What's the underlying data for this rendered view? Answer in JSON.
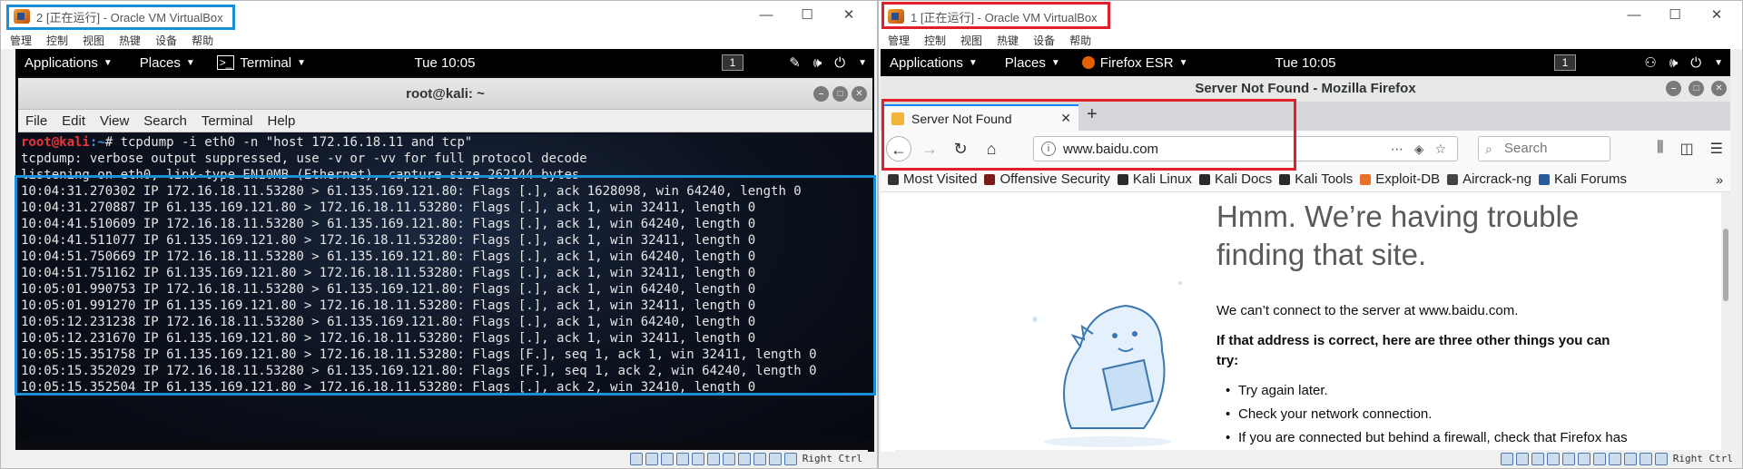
{
  "left_vm": {
    "title": "2 [正在运行] - Oracle VM VirtualBox",
    "menu": [
      "管理",
      "控制",
      "视图",
      "热键",
      "设备",
      "帮助"
    ],
    "gnome": {
      "applications": "Applications",
      "places": "Places",
      "app": "Terminal",
      "clock": "Tue 10:05",
      "workspace": "1"
    },
    "terminal": {
      "title": "root@kali: ~",
      "menu": [
        "File",
        "Edit",
        "View",
        "Search",
        "Terminal",
        "Help"
      ],
      "prompt_user": "root@kali",
      "prompt_path": ":~",
      "prompt_rest": "# tcpdump -i eth0 -n \"host 172.16.18.11 and tcp\"",
      "lines": [
        "tcpdump: verbose output suppressed, use -v or -vv for full protocol decode",
        "listening on eth0, link-type EN10MB (Ethernet), capture size 262144 bytes",
        "10:04:31.270302 IP 172.16.18.11.53280 > 61.135.169.121.80: Flags [.], ack 1628098, win 64240, length 0",
        "10:04:31.270887 IP 61.135.169.121.80 > 172.16.18.11.53280: Flags [.], ack 1, win 32411, length 0",
        "10:04:41.510609 IP 172.16.18.11.53280 > 61.135.169.121.80: Flags [.], ack 1, win 64240, length 0",
        "10:04:41.511077 IP 61.135.169.121.80 > 172.16.18.11.53280: Flags [.], ack 1, win 32411, length 0",
        "10:04:51.750669 IP 172.16.18.11.53280 > 61.135.169.121.80: Flags [.], ack 1, win 64240, length 0",
        "10:04:51.751162 IP 61.135.169.121.80 > 172.16.18.11.53280: Flags [.], ack 1, win 32411, length 0",
        "10:05:01.990753 IP 172.16.18.11.53280 > 61.135.169.121.80: Flags [.], ack 1, win 64240, length 0",
        "10:05:01.991270 IP 61.135.169.121.80 > 172.16.18.11.53280: Flags [.], ack 1, win 32411, length 0",
        "10:05:12.231238 IP 172.16.18.11.53280 > 61.135.169.121.80: Flags [.], ack 1, win 64240, length 0",
        "10:05:12.231670 IP 61.135.169.121.80 > 172.16.18.11.53280: Flags [.], ack 1, win 32411, length 0",
        "10:05:15.351758 IP 61.135.169.121.80 > 172.16.18.11.53280: Flags [F.], seq 1, ack 1, win 32411, length 0",
        "10:05:15.352029 IP 172.16.18.11.53280 > 61.135.169.121.80: Flags [F.], seq 1, ack 2, win 64240, length 0",
        "10:05:15.352504 IP 61.135.169.121.80 > 172.16.18.11.53280: Flags [.], ack 2, win 32410, length 0"
      ]
    },
    "hostkey": "Right Ctrl"
  },
  "right_vm": {
    "title": "1 [正在运行] - Oracle VM VirtualBox",
    "menu": [
      "管理",
      "控制",
      "视图",
      "热键",
      "设备",
      "帮助"
    ],
    "gnome": {
      "applications": "Applications",
      "places": "Places",
      "app": "Firefox ESR",
      "clock": "Tue 10:05",
      "workspace": "1"
    },
    "firefox": {
      "window_title": "Server Not Found - Mozilla Firefox",
      "tab_label": "Server Not Found",
      "url": "www.baidu.com",
      "search_placeholder": "Search",
      "bookmarks": [
        "Most Visited",
        "Offensive Security",
        "Kali Linux",
        "Kali Docs",
        "Kali Tools",
        "Exploit-DB",
        "Aircrack-ng",
        "Kali Forums"
      ],
      "error_title": "Hmm. We’re having trouble finding that site.",
      "error_p1": "We can’t connect to the server at www.baidu.com.",
      "error_p2": "If that address is correct, here are three other things you can try:",
      "error_items": [
        "Try again later.",
        "Check your network connection.",
        "If you are connected but behind a firewall, check that Firefox has permission to access the Web."
      ]
    },
    "hostkey": "Right Ctrl"
  },
  "colors": {
    "highlight_left": "#1a8fd6",
    "highlight_right": "#e0202a",
    "prompt_user": "#e8353a",
    "prompt_path": "#4c8ce0"
  }
}
